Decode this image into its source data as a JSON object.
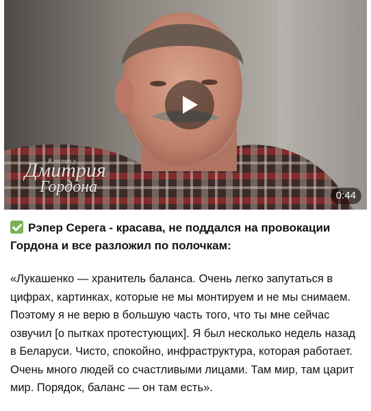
{
  "video": {
    "duration": "0:44",
    "watermark_sub": "В гостях у",
    "watermark_line1": "Дмитрия",
    "watermark_line2": "Гордона",
    "play_icon": "play-icon"
  },
  "post": {
    "headline": "Рэпер Серега - красава, не поддался на провокации Гордона и все разложил по полочкам:",
    "body": "«Лукашенко — хранитель баланса. Очень легко запутаться в цифрах, картинках, которые не мы монтируем и не мы снимаем. Поэтому я не верю в большую часть того, что ты мне сейчас озвучил [о пытках протестующих]. Я был несколько недель назад в Беларуси. Чисто, спокойно, инфраструктура, которая работает. Очень много людей со счастливыми лицами. Там мир, там царит мир. Порядок, баланс — он там есть».",
    "check_icon": "check-mark-icon"
  },
  "colors": {
    "check_green": "#77b255",
    "duration_bg": "rgba(0,0,0,0.55)"
  }
}
